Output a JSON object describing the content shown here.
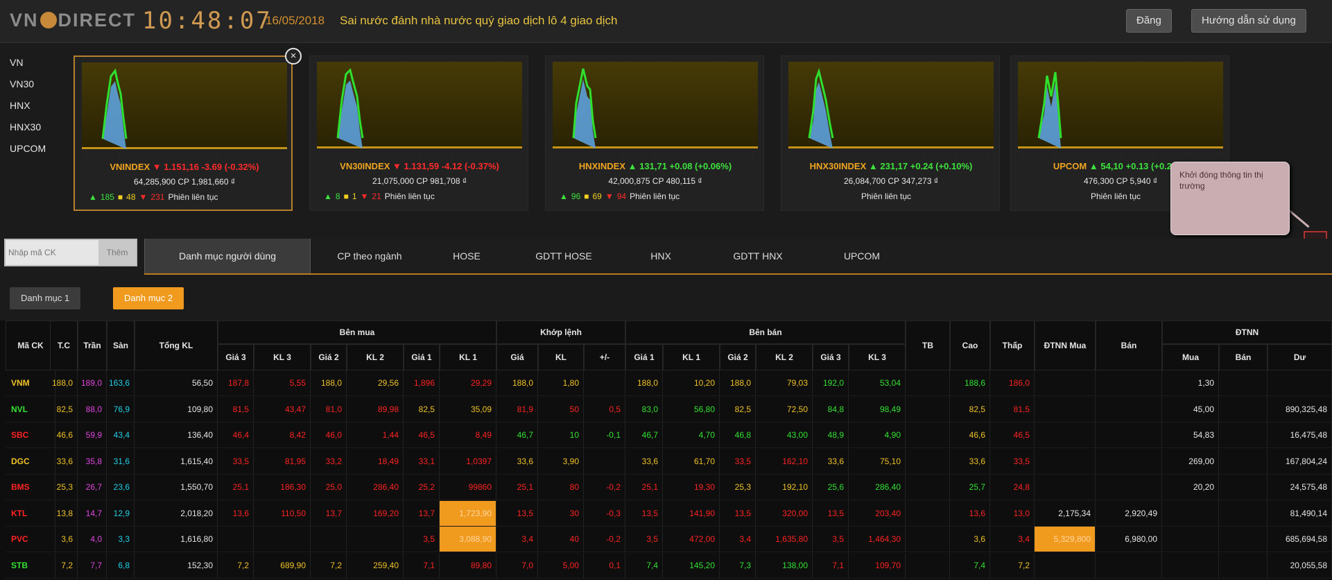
{
  "header": {
    "logo": "VN",
    "logo_tail": "DIRECT",
    "clock": "10:48:07",
    "date": "16/05/2018",
    "message": "Sai nước đánh nhà nước quý giao dịch lô 4 giao dịch",
    "btn_login": "Đăng",
    "btn_guide": "Hướng dẫn sử dụng"
  },
  "index_list": [
    "VN",
    "VN30",
    "HNX",
    "HNX30",
    "UPCOM"
  ],
  "cards": [
    {
      "name": "VNINDEX",
      "change": "1.151,16 -3.69 (-0.32%)",
      "dir": "down",
      "vol_line": "64,285,900 CP 1,981,660 ₫",
      "up": "185",
      "flat": "48",
      "down": "231",
      "status": "Phiên liên tục"
    },
    {
      "name": "VN30INDEX",
      "change": "1.131,59 -4.12 (-0.37%)",
      "dir": "down",
      "vol_line": "21,075,000 CP 981,708 ₫",
      "up": "8",
      "flat": "1",
      "down": "21",
      "status": "Phiên liên tục"
    },
    {
      "name": "HNXINDEX",
      "change": "131,71 +0.08 (+0.06%)",
      "dir": "up",
      "vol_line": "42,000,875 CP 480,115 ₫",
      "up": "96",
      "flat": "69",
      "down": "94",
      "status": "Phiên liên tục"
    },
    {
      "name": "HNX30INDEX",
      "change": "231,17 +0.24 (+0.10%)",
      "dir": "up",
      "vol_line": "26,084,700 CP 347,273 ₫",
      "up": "",
      "flat": "",
      "down": "",
      "status": "Phiên liên tục"
    },
    {
      "name": "UPCOM",
      "change": "54,10 +0.13 (+0.24%)",
      "dir": "up",
      "vol_line": "476,300 CP 5,940 ₫",
      "up": "",
      "flat": "",
      "down": "",
      "status": "Phiên liên tục"
    }
  ],
  "tooltip": "Khởi đóng thông tin thị trường",
  "tooltip_btn": "x",
  "search": {
    "placeholder": "Nhập mã CK",
    "button": "Thêm"
  },
  "tabs": [
    "Danh mục người dùng",
    "CP theo ngành",
    "HOSE",
    "GDTT HOSE",
    "HNX",
    "GDTT HNX",
    "UPCOM"
  ],
  "subtabs": [
    "Danh mục 1",
    "Danh mục 2"
  ],
  "table": {
    "groups": {
      "buy": "Bên mua",
      "match": "Khớp lệnh",
      "sell": "Bên bán",
      "foreign": "ĐTNN"
    },
    "headers": {
      "code": "Mã CK",
      "ref": "T.C",
      "ceil": "Trần",
      "floor": "Sàn",
      "total": "Tổng KL",
      "p3": "Giá 3",
      "v3": "KL 3",
      "p2": "Giá 2",
      "v2": "KL 2",
      "p1": "Giá 1",
      "v1": "KL 1",
      "mp": "Giá",
      "mv": "KL",
      "chg": "+/-",
      "sp1": "Giá 1",
      "sv1": "KL 1",
      "sp2": "Giá 2",
      "sv2": "KL 2",
      "sp3": "Giá 3",
      "sv3": "KL 3",
      "tb": "TB",
      "high": "Cao",
      "low": "Thấp",
      "fbuy": "ĐTNN Mua",
      "fsell": "Bán",
      "nbuy": "Mua",
      "nsell": "Bán",
      "room": "Dư"
    },
    "rows": [
      {
        "code": "VNM",
        "c": "cy",
        "ref": "188,0",
        "ceil": "189,0",
        "floor": "163,6",
        "total": "56,50",
        "b": [
          "187,8",
          "5,55",
          "188,0",
          "29,56",
          "1,896",
          "29,29"
        ],
        "m": [
          "188,0",
          "1,80",
          ""
        ],
        "s": [
          "188,0",
          "10,20",
          "188,0",
          "79,03",
          "192,0",
          "53,04"
        ],
        "hi": "188,6",
        "lo": "186,0",
        "f1": "",
        "f2": "",
        "n1": "1,30",
        "n2": "",
        "room": ""
      },
      {
        "code": "NVL",
        "c": "cg",
        "ref": "82,5",
        "ceil": "88,0",
        "floor": "76,9",
        "total": "109,80",
        "b": [
          "81,5",
          "43,47",
          "81,0",
          "89,98",
          "82,5",
          "35,09"
        ],
        "m": [
          "81,9",
          "50",
          "0,5"
        ],
        "s": [
          "83,0",
          "56,80",
          "82,5",
          "72,50",
          "84,8",
          "98,49"
        ],
        "hi": "82,5",
        "lo": "81,5",
        "f1": "",
        "f2": "",
        "n1": "45,00",
        "n2": "",
        "room": "890,325,48"
      },
      {
        "code": "SBC",
        "c": "cr",
        "ref": "46,6",
        "ceil": "59,9",
        "floor": "43,4",
        "total": "136,40",
        "b": [
          "46,4",
          "8,42",
          "46,0",
          "1,44",
          "46,5",
          "8,49"
        ],
        "m": [
          "46,7",
          "10",
          "-0,1"
        ],
        "s": [
          "46,7",
          "4,70",
          "46,8",
          "43,00",
          "48,9",
          "4,90"
        ],
        "hi": "46,6",
        "lo": "46,5",
        "f1": "",
        "f2": "",
        "n1": "54,83",
        "n2": "",
        "room": "16,475,48"
      },
      {
        "code": "DGC",
        "c": "cy",
        "ref": "33,6",
        "ceil": "35,8",
        "floor": "31,6",
        "total": "1,615,40",
        "b": [
          "33,5",
          "81,95",
          "33,2",
          "18,49",
          "33,1",
          "1,0397"
        ],
        "m": [
          "33,6",
          "3,90",
          ""
        ],
        "s": [
          "33,6",
          "61,70",
          "33,5",
          "162,10",
          "33,6",
          "75,10"
        ],
        "hi": "33,6",
        "lo": "33,5",
        "f1": "",
        "f2": "",
        "n1": "269,00",
        "n2": "",
        "room": "167,804,24"
      },
      {
        "code": "BMS",
        "c": "cr",
        "ref": "25,3",
        "ceil": "26,7",
        "floor": "23,6",
        "total": "1,550,70",
        "b": [
          "25,1",
          "186,30",
          "25,0",
          "286,40",
          "25,2",
          "99860"
        ],
        "m": [
          "25,1",
          "80",
          "-0,2"
        ],
        "s": [
          "25,1",
          "19,30",
          "25,3",
          "192,10",
          "25,6",
          "286,40"
        ],
        "hi": "25,7",
        "lo": "24,8",
        "f1": "",
        "f2": "",
        "n1": "20,20",
        "n2": "",
        "room": "24,575,48"
      },
      {
        "code": "KTL",
        "c": "cr",
        "ref": "13,8",
        "ceil": "14,7",
        "floor": "12,9",
        "total": "2,018,20",
        "b": [
          "13,6",
          "110,50",
          "13,7",
          "169,20",
          "13,7",
          "1,723,90"
        ],
        "m": [
          "13,5",
          "30",
          "-0,3"
        ],
        "s": [
          "13,5",
          "141,90",
          "13,5",
          "320,00",
          "13,5",
          "203,40"
        ],
        "hi": "13,6",
        "lo": "13,0",
        "f1": "2,175,34",
        "f2": "2,920,49",
        "n1": "",
        "n2": "",
        "room": "81,490,14"
      },
      {
        "code": "PVC",
        "c": "cr",
        "ref": "3,6",
        "ceil": "4,0",
        "floor": "3,3",
        "total": "1,616,80",
        "b": [
          "",
          "",
          "",
          "",
          "3,5",
          "3,088,90"
        ],
        "m": [
          "3,4",
          "40",
          "-0,2"
        ],
        "s": [
          "3,5",
          "472,00",
          "3,4",
          "1,635,80",
          "3,5",
          "1,464,30"
        ],
        "hi": "3,6",
        "lo": "3,4",
        "f1": "5,329,800",
        "f2": "6,980,00",
        "n1": "",
        "n2": "",
        "room": "685,694,58"
      },
      {
        "code": "STB",
        "c": "cg",
        "ref": "7,2",
        "ceil": "7,7",
        "floor": "6,8",
        "total": "152,30",
        "b": [
          "7,2",
          "689,90",
          "7,2",
          "259,40",
          "7,1",
          "89,80"
        ],
        "m": [
          "7,0",
          "5,00",
          "0,1"
        ],
        "s": [
          "7,4",
          "145,20",
          "7,3",
          "138,00",
          "7,1",
          "109,70"
        ],
        "hi": "7,4",
        "lo": "7,2",
        "f1": "",
        "f2": "",
        "n1": "",
        "n2": "",
        "room": "20,055,58"
      }
    ]
  }
}
